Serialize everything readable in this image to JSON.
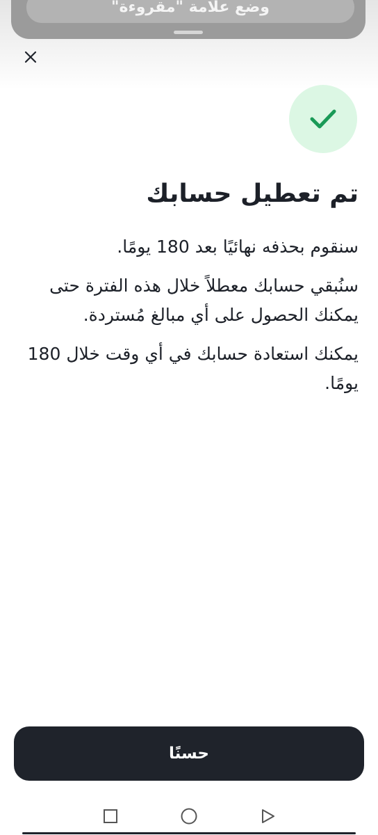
{
  "notification": {
    "action_label": "وضع علامة \"مقروءة\""
  },
  "icons": {
    "close": "close-icon",
    "success": "check-icon",
    "nav_recents": "square-icon",
    "nav_home": "circle-icon",
    "nav_back": "triangle-back-icon"
  },
  "main": {
    "title": "تم تعطيل حسابك",
    "paragraphs": [
      "سنقوم بحذفه نهائيًا بعد 180 يومًا.",
      "سنُبقي حسابك معطلاً خلال هذه الفترة حتى يمكنك الحصول على أي مبالغ مُستردة.",
      "يمكنك استعادة حسابك في أي وقت خلال 180 يومًا."
    ]
  },
  "button": {
    "ok_label": "حسنًا"
  },
  "colors": {
    "accent_green": "#1a9a57",
    "success_bg": "#dcf7e4",
    "button_bg": "#1f232b",
    "text": "#1c2028"
  }
}
